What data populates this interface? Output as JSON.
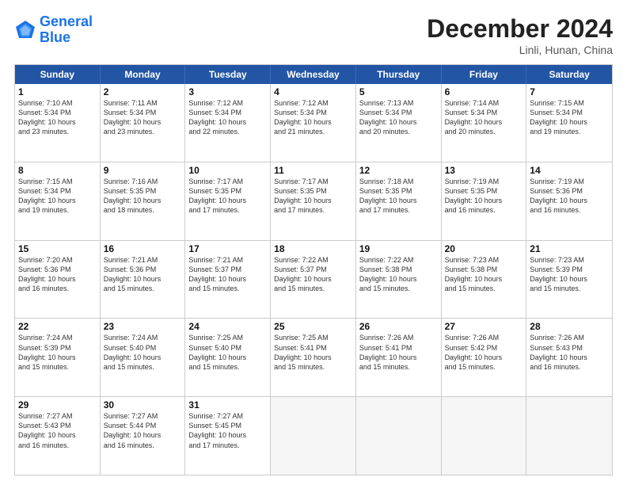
{
  "header": {
    "logo_line1": "General",
    "logo_line2": "Blue",
    "month": "December 2024",
    "location": "Linli, Hunan, China"
  },
  "weekdays": [
    "Sunday",
    "Monday",
    "Tuesday",
    "Wednesday",
    "Thursday",
    "Friday",
    "Saturday"
  ],
  "rows": [
    [
      {
        "day": "1",
        "lines": [
          "Sunrise: 7:10 AM",
          "Sunset: 5:34 PM",
          "Daylight: 10 hours",
          "and 23 minutes."
        ]
      },
      {
        "day": "2",
        "lines": [
          "Sunrise: 7:11 AM",
          "Sunset: 5:34 PM",
          "Daylight: 10 hours",
          "and 23 minutes."
        ]
      },
      {
        "day": "3",
        "lines": [
          "Sunrise: 7:12 AM",
          "Sunset: 5:34 PM",
          "Daylight: 10 hours",
          "and 22 minutes."
        ]
      },
      {
        "day": "4",
        "lines": [
          "Sunrise: 7:12 AM",
          "Sunset: 5:34 PM",
          "Daylight: 10 hours",
          "and 21 minutes."
        ]
      },
      {
        "day": "5",
        "lines": [
          "Sunrise: 7:13 AM",
          "Sunset: 5:34 PM",
          "Daylight: 10 hours",
          "and 20 minutes."
        ]
      },
      {
        "day": "6",
        "lines": [
          "Sunrise: 7:14 AM",
          "Sunset: 5:34 PM",
          "Daylight: 10 hours",
          "and 20 minutes."
        ]
      },
      {
        "day": "7",
        "lines": [
          "Sunrise: 7:15 AM",
          "Sunset: 5:34 PM",
          "Daylight: 10 hours",
          "and 19 minutes."
        ]
      }
    ],
    [
      {
        "day": "8",
        "lines": [
          "Sunrise: 7:15 AM",
          "Sunset: 5:34 PM",
          "Daylight: 10 hours",
          "and 19 minutes."
        ]
      },
      {
        "day": "9",
        "lines": [
          "Sunrise: 7:16 AM",
          "Sunset: 5:35 PM",
          "Daylight: 10 hours",
          "and 18 minutes."
        ]
      },
      {
        "day": "10",
        "lines": [
          "Sunrise: 7:17 AM",
          "Sunset: 5:35 PM",
          "Daylight: 10 hours",
          "and 17 minutes."
        ]
      },
      {
        "day": "11",
        "lines": [
          "Sunrise: 7:17 AM",
          "Sunset: 5:35 PM",
          "Daylight: 10 hours",
          "and 17 minutes."
        ]
      },
      {
        "day": "12",
        "lines": [
          "Sunrise: 7:18 AM",
          "Sunset: 5:35 PM",
          "Daylight: 10 hours",
          "and 17 minutes."
        ]
      },
      {
        "day": "13",
        "lines": [
          "Sunrise: 7:19 AM",
          "Sunset: 5:35 PM",
          "Daylight: 10 hours",
          "and 16 minutes."
        ]
      },
      {
        "day": "14",
        "lines": [
          "Sunrise: 7:19 AM",
          "Sunset: 5:36 PM",
          "Daylight: 10 hours",
          "and 16 minutes."
        ]
      }
    ],
    [
      {
        "day": "15",
        "lines": [
          "Sunrise: 7:20 AM",
          "Sunset: 5:36 PM",
          "Daylight: 10 hours",
          "and 16 minutes."
        ]
      },
      {
        "day": "16",
        "lines": [
          "Sunrise: 7:21 AM",
          "Sunset: 5:36 PM",
          "Daylight: 10 hours",
          "and 15 minutes."
        ]
      },
      {
        "day": "17",
        "lines": [
          "Sunrise: 7:21 AM",
          "Sunset: 5:37 PM",
          "Daylight: 10 hours",
          "and 15 minutes."
        ]
      },
      {
        "day": "18",
        "lines": [
          "Sunrise: 7:22 AM",
          "Sunset: 5:37 PM",
          "Daylight: 10 hours",
          "and 15 minutes."
        ]
      },
      {
        "day": "19",
        "lines": [
          "Sunrise: 7:22 AM",
          "Sunset: 5:38 PM",
          "Daylight: 10 hours",
          "and 15 minutes."
        ]
      },
      {
        "day": "20",
        "lines": [
          "Sunrise: 7:23 AM",
          "Sunset: 5:38 PM",
          "Daylight: 10 hours",
          "and 15 minutes."
        ]
      },
      {
        "day": "21",
        "lines": [
          "Sunrise: 7:23 AM",
          "Sunset: 5:39 PM",
          "Daylight: 10 hours",
          "and 15 minutes."
        ]
      }
    ],
    [
      {
        "day": "22",
        "lines": [
          "Sunrise: 7:24 AM",
          "Sunset: 5:39 PM",
          "Daylight: 10 hours",
          "and 15 minutes."
        ]
      },
      {
        "day": "23",
        "lines": [
          "Sunrise: 7:24 AM",
          "Sunset: 5:40 PM",
          "Daylight: 10 hours",
          "and 15 minutes."
        ]
      },
      {
        "day": "24",
        "lines": [
          "Sunrise: 7:25 AM",
          "Sunset: 5:40 PM",
          "Daylight: 10 hours",
          "and 15 minutes."
        ]
      },
      {
        "day": "25",
        "lines": [
          "Sunrise: 7:25 AM",
          "Sunset: 5:41 PM",
          "Daylight: 10 hours",
          "and 15 minutes."
        ]
      },
      {
        "day": "26",
        "lines": [
          "Sunrise: 7:26 AM",
          "Sunset: 5:41 PM",
          "Daylight: 10 hours",
          "and 15 minutes."
        ]
      },
      {
        "day": "27",
        "lines": [
          "Sunrise: 7:26 AM",
          "Sunset: 5:42 PM",
          "Daylight: 10 hours",
          "and 15 minutes."
        ]
      },
      {
        "day": "28",
        "lines": [
          "Sunrise: 7:26 AM",
          "Sunset: 5:43 PM",
          "Daylight: 10 hours",
          "and 16 minutes."
        ]
      }
    ],
    [
      {
        "day": "29",
        "lines": [
          "Sunrise: 7:27 AM",
          "Sunset: 5:43 PM",
          "Daylight: 10 hours",
          "and 16 minutes."
        ]
      },
      {
        "day": "30",
        "lines": [
          "Sunrise: 7:27 AM",
          "Sunset: 5:44 PM",
          "Daylight: 10 hours",
          "and 16 minutes."
        ]
      },
      {
        "day": "31",
        "lines": [
          "Sunrise: 7:27 AM",
          "Sunset: 5:45 PM",
          "Daylight: 10 hours",
          "and 17 minutes."
        ]
      },
      {
        "day": "",
        "lines": []
      },
      {
        "day": "",
        "lines": []
      },
      {
        "day": "",
        "lines": []
      },
      {
        "day": "",
        "lines": []
      }
    ]
  ]
}
